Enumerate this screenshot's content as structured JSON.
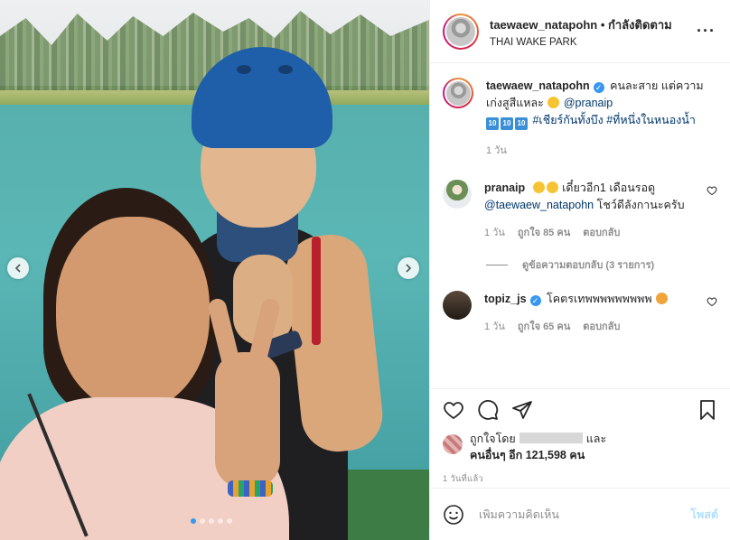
{
  "header": {
    "username": "taewaew_natapohn",
    "separator": "•",
    "follow_status": "กำลังติดตาม",
    "location": "THAI WAKE PARK",
    "more_icon": "more-horizontal-icon"
  },
  "caption": {
    "username": "taewaew_natapohn",
    "text_1": "คนละสาย แต่ความเก่งสูสีแหละ",
    "mention": "@pranaip",
    "hashtags": "#เชียร์กันทั้งบึง #ที่หนึ่งในหนองน้ำ",
    "badge_emoji_label": "10",
    "age": "1 วัน"
  },
  "comments": [
    {
      "username": "pranaip",
      "text_1": "เดี๋ยวอีก1 เดือนรอดู",
      "mention": "@taewaew_natapohn",
      "text_2": "โชว์ดีลังกานะครับ",
      "age": "1 วัน",
      "likes": "ถูกใจ 85 คน",
      "reply": "ตอบกลับ",
      "view_replies": "ดูข้อความตอบกลับ (3 รายการ)"
    },
    {
      "username": "topiz_js",
      "text_1": "โคตรเทพพพพพพพพพ",
      "age": "1 วัน",
      "likes": "ถูกใจ 65 คน",
      "reply": "ตอบกลับ"
    }
  ],
  "liked_by": {
    "prefix": "ถูกใจโดย",
    "suffix": "และ",
    "others": "คนอื่นๆ อีก 121,598 คน"
  },
  "timestamp": "1 วันที่แล้ว",
  "add_comment": {
    "placeholder": "เพิ่มความคิดเห็น",
    "post_label": "โพสต์"
  },
  "colors": {
    "link": "#00376b",
    "verified": "#3897f0",
    "muted": "#8e8e8e",
    "post_button_disabled": "#b2dffc"
  },
  "carousel": {
    "slide_count": 5,
    "active_slide": 1
  }
}
